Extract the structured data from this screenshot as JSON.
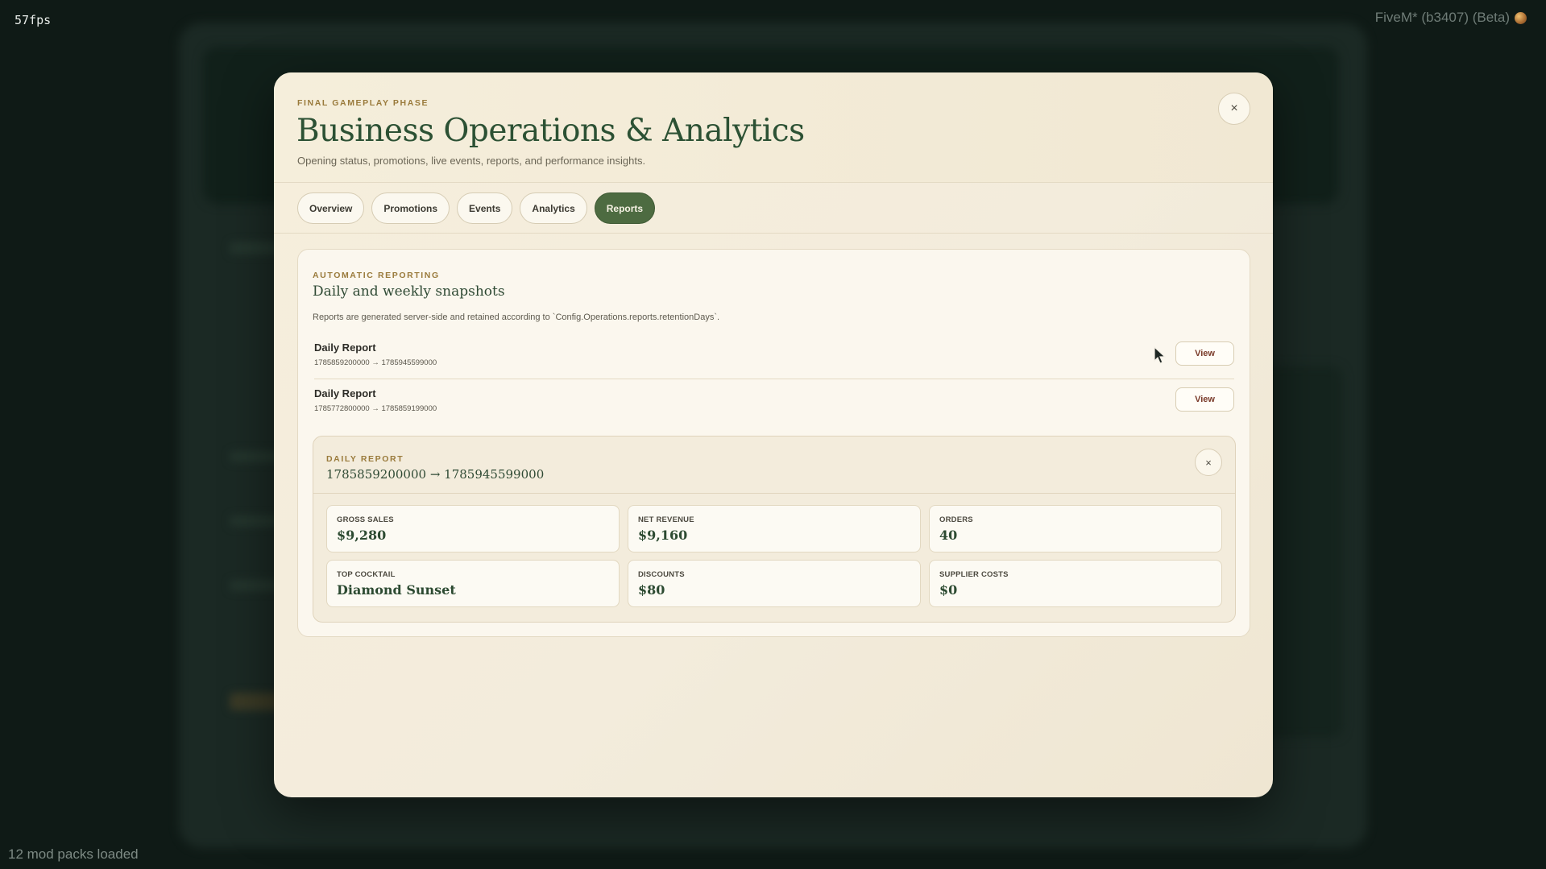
{
  "overlay": {
    "fps": "57fps",
    "build": "FiveM* (b3407) (Beta)",
    "mods": "12 mod packs loaded"
  },
  "modal": {
    "eyebrow": "FINAL GAMEPLAY PHASE",
    "title": "Business Operations & Analytics",
    "subtitle": "Opening status, promotions, live events, reports, and performance insights.",
    "close_icon": "×",
    "tabs": [
      {
        "label": "Overview",
        "active": false
      },
      {
        "label": "Promotions",
        "active": false
      },
      {
        "label": "Events",
        "active": false
      },
      {
        "label": "Analytics",
        "active": false
      },
      {
        "label": "Reports",
        "active": true
      }
    ]
  },
  "reports": {
    "eyebrow": "AUTOMATIC REPORTING",
    "title": "Daily and weekly snapshots",
    "description": "Reports are generated server-side and retained according to `Config.Operations.reports.retentionDays`.",
    "items": [
      {
        "title": "Daily Report",
        "range": "1785859200000 → 1785945599000",
        "view_label": "View"
      },
      {
        "title": "Daily Report",
        "range": "1785772800000 → 1785859199000",
        "view_label": "View"
      }
    ]
  },
  "detail": {
    "eyebrow": "DAILY REPORT",
    "range": "1785859200000 → 1785945599000",
    "close_icon": "×",
    "stats": [
      {
        "label": "GROSS SALES",
        "value": "$9,280"
      },
      {
        "label": "NET REVENUE",
        "value": "$9,160"
      },
      {
        "label": "ORDERS",
        "value": "40"
      },
      {
        "label": "TOP COCKTAIL",
        "value": "Diamond Sunset"
      },
      {
        "label": "DISCOUNTS",
        "value": "$80"
      },
      {
        "label": "SUPPLIER COSTS",
        "value": "$0"
      }
    ]
  },
  "colors": {
    "accent": "#4d6b41",
    "title": "#2c5134",
    "eyebrow": "#9a7b3c",
    "view_text": "#7a3b2a"
  }
}
